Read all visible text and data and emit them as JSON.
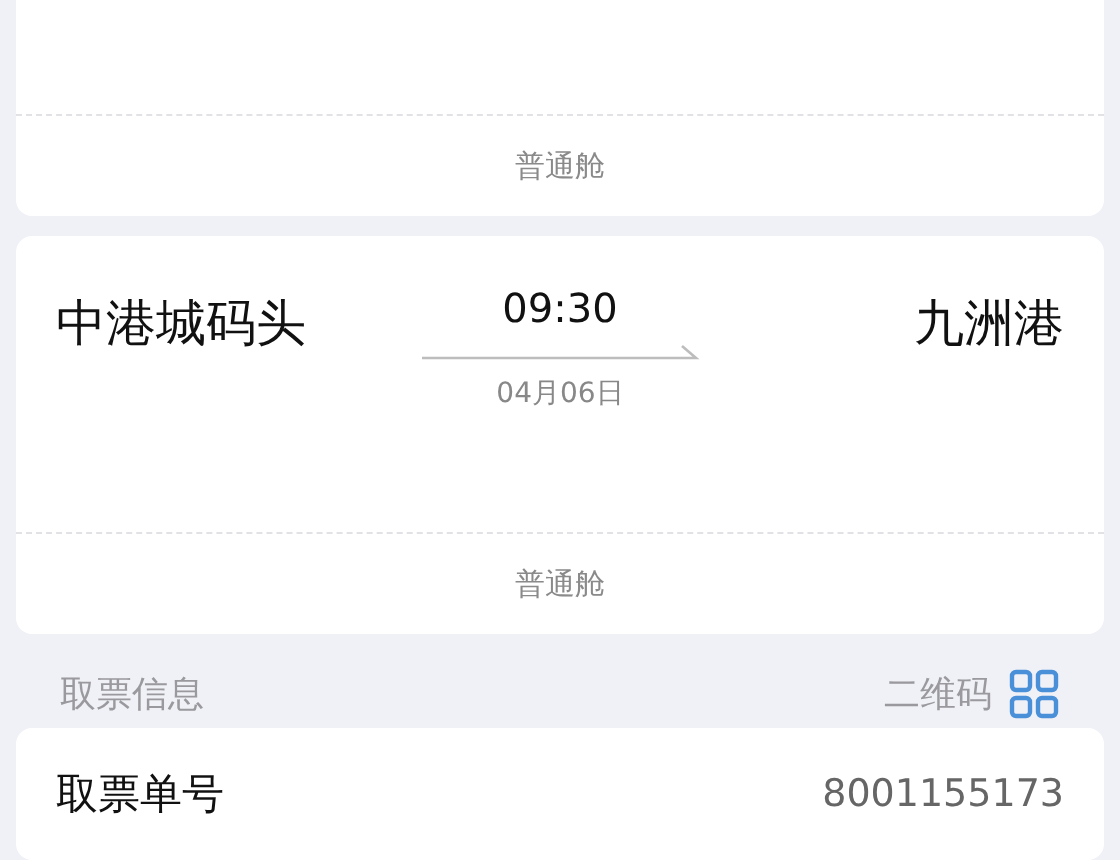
{
  "trips": [
    {
      "cabin": "普通舱"
    },
    {
      "from": "中港城码头",
      "to": "九洲港",
      "time": "09:30",
      "date": "04月06日",
      "cabin": "普通舱"
    }
  ],
  "pickup": {
    "title": "取票信息",
    "qr_label": "二维码",
    "rows": [
      {
        "label": "取票单号",
        "value": "8001155173"
      }
    ]
  }
}
